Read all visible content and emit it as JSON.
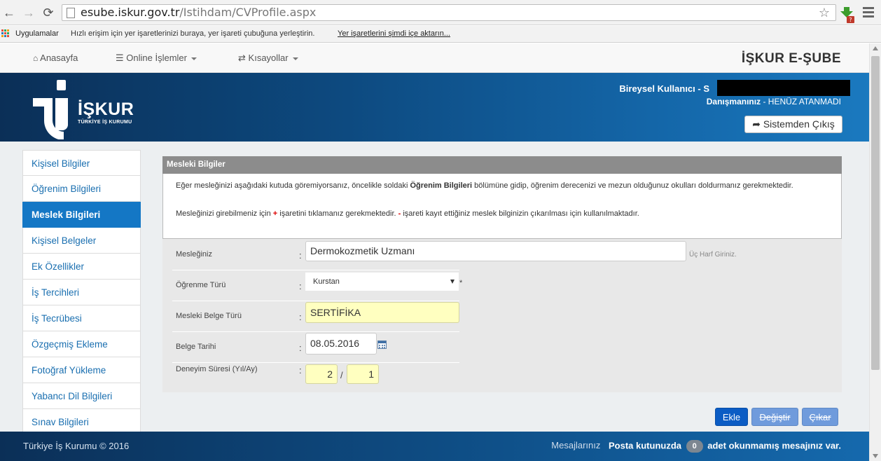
{
  "browser": {
    "url_host": "esube.iskur.gov.tr",
    "url_path": "/Istihdam/CVProfile.aspx",
    "bookmarks": {
      "apps_label": "Uygulamalar",
      "hint": "Hızlı erişim için yer işaretlerinizi buraya, yer işareti çubuğuna yerleştirin.",
      "import_link": "Yer işaretlerini şimdi içe aktarın..."
    }
  },
  "site_nav": {
    "home": "Anasayfa",
    "online": "Online İşlemler",
    "shortcuts": "Kısayollar",
    "brand": "İŞKUR E-ŞUBE"
  },
  "header": {
    "logo_text": "İŞKUR",
    "logo_sub": "TÜRKİYE İŞ KURUMU",
    "user_label": "Bireysel Kullanıcı - S",
    "advisor_label": "Danışmanınız",
    "advisor_value": " - HENÜZ ATANMADI",
    "logout": "Sistemden Çıkış"
  },
  "sidebar": {
    "items": [
      {
        "label": "Kişisel Bilgiler",
        "active": false
      },
      {
        "label": "Öğrenim Bilgileri",
        "active": false
      },
      {
        "label": "Meslek Bilgileri",
        "active": true
      },
      {
        "label": "Kişisel Belgeler",
        "active": false
      },
      {
        "label": "Ek Özellikler",
        "active": false
      },
      {
        "label": "İş Tercihleri",
        "active": false
      },
      {
        "label": "İş Tecrübesi",
        "active": false
      },
      {
        "label": "Özgeçmiş Ekleme",
        "active": false
      },
      {
        "label": "Fotoğraf Yükleme",
        "active": false
      },
      {
        "label": "Yabancı Dil Bilgileri",
        "active": false
      },
      {
        "label": "Sınav Bilgileri",
        "active": false
      }
    ]
  },
  "panel": {
    "title": "Mesleki Bilgiler",
    "info_line1_a": "Eğer mesleğinizi aşağıdaki kutuda göremiyorsanız, öncelikle soldaki ",
    "info_line1_b": "Öğrenim Bilgileri",
    "info_line1_c": " bölümüne gidip, öğrenim derecenizi ve mezun olduğunuz okulları doldurmanız gerekmektedir.",
    "info_line2_a": "Mesleğinizi girebilmeniz için ",
    "info_plus": "+",
    "info_line2_b": " işaretini tıklamanız gerekmektedir. ",
    "info_minus": "-",
    "info_line2_c": " işareti kayıt ettiğiniz meslek bilginizin çıkarılması için kullanılmaktadır."
  },
  "form": {
    "colon": ":",
    "occupation": {
      "label": "Mesleğiniz",
      "value": "Dermokozmetik Uzmanı",
      "hint": "Üç Harf Giriniz."
    },
    "learning_type": {
      "label": "Öğrenme Türü",
      "value": "Kurstan",
      "required": "*"
    },
    "certificate_type": {
      "label": "Mesleki Belge Türü",
      "value": "SERTİFİKA"
    },
    "certificate_date": {
      "label": "Belge Tarihi",
      "value": "08.05.2016"
    },
    "experience": {
      "label": "Deneyim Süresi (Yıl/Ay)",
      "years": "2",
      "separator": "/",
      "months": "1"
    }
  },
  "buttons": {
    "add": "Ekle",
    "change": "Değiştir",
    "remove": "Çıkar"
  },
  "footer": {
    "copyright": "Türkiye İş Kurumu © 2016",
    "messages_label": "Mesajlarınız",
    "inbox_prefix": "Posta kutunuzda",
    "unread_count": "0",
    "inbox_suffix": "adet okunmamış mesajınız var."
  },
  "colors": {
    "active_sidebar": "#1477c5",
    "add_button": "#0b5cc4",
    "disabled_button": "#6f9bdc",
    "highlight_field": "#ffffc0",
    "header_gradient_start": "#0b2f57",
    "header_gradient_end": "#1a79bf"
  }
}
